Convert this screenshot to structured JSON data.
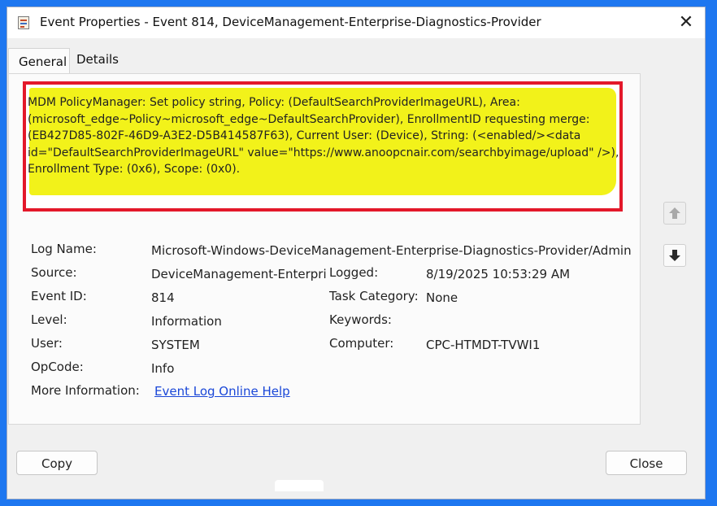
{
  "window": {
    "title": "Event Properties - Event 814, DeviceManagement-Enterprise-Diagnostics-Provider",
    "close_symbol": "✕"
  },
  "tabs": [
    {
      "label": "General",
      "selected": true
    },
    {
      "label": "Details",
      "selected": false
    }
  ],
  "description": "MDM PolicyManager: Set policy string, Policy: (DefaultSearchProviderImageURL), Area: (microsoft_edge~Policy~microsoft_edge~DefaultSearchProvider), EnrollmentID requesting merge: (EB427D85-802F-46D9-A3E2-D5B414587F63), Current User: (Device), String: (<enabled/><data id=\"DefaultSearchProviderImageURL\" value=\"https://www.anoopcnair.com/searchbyimage/upload\" />), Enrollment Type: (0x6), Scope: (0x0).",
  "fields": {
    "log_name": {
      "label": "Log Name:",
      "value": "Microsoft-Windows-DeviceManagement-Enterprise-Diagnostics-Provider/Admin"
    },
    "source": {
      "label": "Source:",
      "value": "DeviceManagement-Enterpri"
    },
    "logged": {
      "label": "Logged:",
      "value": "8/19/2025 10:53:29 AM"
    },
    "event_id": {
      "label": "Event ID:",
      "value": "814"
    },
    "task_category": {
      "label": "Task Category:",
      "value": "None"
    },
    "level": {
      "label": "Level:",
      "value": "Information"
    },
    "keywords": {
      "label": "Keywords:",
      "value": ""
    },
    "user": {
      "label": "User:",
      "value": "SYSTEM"
    },
    "computer": {
      "label": "Computer:",
      "value": "CPC-HTMDT-TVWI1"
    },
    "opcode": {
      "label": "OpCode:",
      "value": "Info"
    },
    "more_info": {
      "label": "More Information:",
      "link": "Event Log Online Help"
    }
  },
  "buttons": {
    "copy": "Copy",
    "close": "Close"
  },
  "icons": {
    "up": "arrow-up-icon",
    "down": "arrow-down-icon"
  },
  "colors": {
    "highlight": "#f2f21a",
    "annotation_border": "#e3182a",
    "link": "#1a47d8",
    "backdrop": "#1e77f0"
  }
}
